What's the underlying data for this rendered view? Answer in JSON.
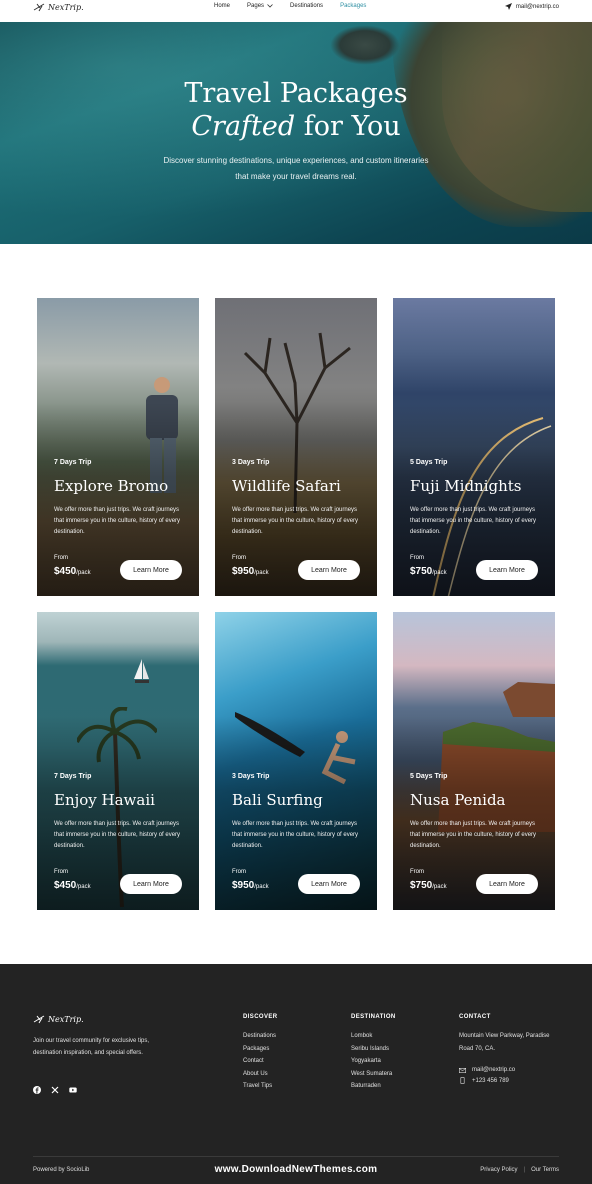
{
  "nav": {
    "logo": "NexTrip.",
    "links": [
      {
        "label": "Home",
        "active": false
      },
      {
        "label": "Pages",
        "active": false,
        "has_dropdown": true
      },
      {
        "label": "Destinations",
        "active": false
      },
      {
        "label": "Packages",
        "active": true
      }
    ],
    "email": "mail@nextrip.co"
  },
  "hero": {
    "title_line1": "Travel Packages",
    "title_em": "Crafted",
    "title_rest": " for You",
    "subtitle": "Discover stunning destinations, unique experiences, and custom itineraries that make your travel dreams real."
  },
  "packages": [
    {
      "trip": "7 Days Trip",
      "title": "Explore Bromo",
      "desc": "We offer more than just trips. We craft journeys that immerse you in the culture, history of every destination.",
      "from": "From",
      "price": "$450",
      "unit": "/pack",
      "button": "Learn More"
    },
    {
      "trip": "3 Days Trip",
      "title": "Wildlife Safari",
      "desc": "We offer more than just trips. We craft journeys that immerse you in the culture, history of every destination.",
      "from": "From",
      "price": "$950",
      "unit": "/pack",
      "button": "Learn More"
    },
    {
      "trip": "5 Days Trip",
      "title": "Fuji Midnights",
      "desc": "We offer more than just trips. We craft journeys that immerse you in the culture, history of every destination.",
      "from": "From",
      "price": "$750",
      "unit": "/pack",
      "button": "Learn More"
    },
    {
      "trip": "7 Days Trip",
      "title": "Enjoy Hawaii",
      "desc": "We offer more than just trips. We craft journeys that immerse you in the culture, history of every destination.",
      "from": "From",
      "price": "$450",
      "unit": "/pack",
      "button": "Learn More"
    },
    {
      "trip": "3 Days Trip",
      "title": "Bali Surfing",
      "desc": "We offer more than just trips. We craft journeys that immerse you in the culture, history of every destination.",
      "from": "From",
      "price": "$950",
      "unit": "/pack",
      "button": "Learn More"
    },
    {
      "trip": "5 Days Trip",
      "title": "Nusa Penida",
      "desc": "We offer more than just trips. We craft journeys that immerse you in the culture, history of every destination.",
      "from": "From",
      "price": "$750",
      "unit": "/pack",
      "button": "Learn More"
    }
  ],
  "footer": {
    "logo": "NexTrip.",
    "about": "Join our travel community for exclusive tips, destination inspiration, and special offers.",
    "social_icons": [
      "facebook-icon",
      "x-icon",
      "youtube-icon"
    ],
    "discover": {
      "heading": "DISCOVER",
      "items": [
        "Destinations",
        "Packages",
        "Contact",
        "About Us",
        "Travel Tips"
      ]
    },
    "destination": {
      "heading": "DESTINATION",
      "items": [
        "Lombok",
        "Seribu Islands",
        "Yogyakarta",
        "West Sumatera",
        "Baturraden"
      ]
    },
    "contact": {
      "heading": "CONTACT",
      "address": "Mountain View Parkway, Paradise Road 70, CA.",
      "email": "mail@nextrip.co",
      "phone": "+123 456 789"
    },
    "powered": "Powered by SocioLib",
    "watermark": "www.DownloadNewThemes.com",
    "privacy": "Privacy Policy",
    "terms": "Our Terms"
  },
  "colors": {
    "accent": "#2e8fa3",
    "footer_bg": "#232323"
  }
}
